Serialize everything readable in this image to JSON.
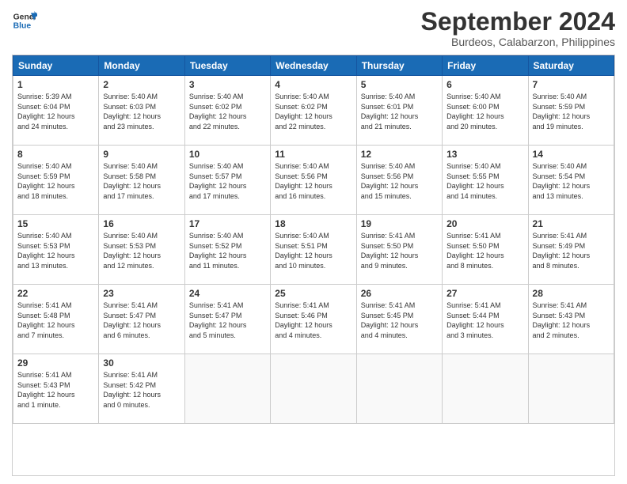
{
  "header": {
    "logo_line1": "General",
    "logo_line2": "Blue",
    "month": "September 2024",
    "location": "Burdeos, Calabarzon, Philippines"
  },
  "days_of_week": [
    "Sunday",
    "Monday",
    "Tuesday",
    "Wednesday",
    "Thursday",
    "Friday",
    "Saturday"
  ],
  "weeks": [
    [
      {
        "day": "1",
        "lines": [
          "Sunrise: 5:39 AM",
          "Sunset: 6:04 PM",
          "Daylight: 12 hours",
          "and 24 minutes."
        ]
      },
      {
        "day": "2",
        "lines": [
          "Sunrise: 5:40 AM",
          "Sunset: 6:03 PM",
          "Daylight: 12 hours",
          "and 23 minutes."
        ]
      },
      {
        "day": "3",
        "lines": [
          "Sunrise: 5:40 AM",
          "Sunset: 6:02 PM",
          "Daylight: 12 hours",
          "and 22 minutes."
        ]
      },
      {
        "day": "4",
        "lines": [
          "Sunrise: 5:40 AM",
          "Sunset: 6:02 PM",
          "Daylight: 12 hours",
          "and 22 minutes."
        ]
      },
      {
        "day": "5",
        "lines": [
          "Sunrise: 5:40 AM",
          "Sunset: 6:01 PM",
          "Daylight: 12 hours",
          "and 21 minutes."
        ]
      },
      {
        "day": "6",
        "lines": [
          "Sunrise: 5:40 AM",
          "Sunset: 6:00 PM",
          "Daylight: 12 hours",
          "and 20 minutes."
        ]
      },
      {
        "day": "7",
        "lines": [
          "Sunrise: 5:40 AM",
          "Sunset: 5:59 PM",
          "Daylight: 12 hours",
          "and 19 minutes."
        ]
      }
    ],
    [
      {
        "day": "8",
        "lines": [
          "Sunrise: 5:40 AM",
          "Sunset: 5:59 PM",
          "Daylight: 12 hours",
          "and 18 minutes."
        ]
      },
      {
        "day": "9",
        "lines": [
          "Sunrise: 5:40 AM",
          "Sunset: 5:58 PM",
          "Daylight: 12 hours",
          "and 17 minutes."
        ]
      },
      {
        "day": "10",
        "lines": [
          "Sunrise: 5:40 AM",
          "Sunset: 5:57 PM",
          "Daylight: 12 hours",
          "and 17 minutes."
        ]
      },
      {
        "day": "11",
        "lines": [
          "Sunrise: 5:40 AM",
          "Sunset: 5:56 PM",
          "Daylight: 12 hours",
          "and 16 minutes."
        ]
      },
      {
        "day": "12",
        "lines": [
          "Sunrise: 5:40 AM",
          "Sunset: 5:56 PM",
          "Daylight: 12 hours",
          "and 15 minutes."
        ]
      },
      {
        "day": "13",
        "lines": [
          "Sunrise: 5:40 AM",
          "Sunset: 5:55 PM",
          "Daylight: 12 hours",
          "and 14 minutes."
        ]
      },
      {
        "day": "14",
        "lines": [
          "Sunrise: 5:40 AM",
          "Sunset: 5:54 PM",
          "Daylight: 12 hours",
          "and 13 minutes."
        ]
      }
    ],
    [
      {
        "day": "15",
        "lines": [
          "Sunrise: 5:40 AM",
          "Sunset: 5:53 PM",
          "Daylight: 12 hours",
          "and 13 minutes."
        ]
      },
      {
        "day": "16",
        "lines": [
          "Sunrise: 5:40 AM",
          "Sunset: 5:53 PM",
          "Daylight: 12 hours",
          "and 12 minutes."
        ]
      },
      {
        "day": "17",
        "lines": [
          "Sunrise: 5:40 AM",
          "Sunset: 5:52 PM",
          "Daylight: 12 hours",
          "and 11 minutes."
        ]
      },
      {
        "day": "18",
        "lines": [
          "Sunrise: 5:40 AM",
          "Sunset: 5:51 PM",
          "Daylight: 12 hours",
          "and 10 minutes."
        ]
      },
      {
        "day": "19",
        "lines": [
          "Sunrise: 5:41 AM",
          "Sunset: 5:50 PM",
          "Daylight: 12 hours",
          "and 9 minutes."
        ]
      },
      {
        "day": "20",
        "lines": [
          "Sunrise: 5:41 AM",
          "Sunset: 5:50 PM",
          "Daylight: 12 hours",
          "and 8 minutes."
        ]
      },
      {
        "day": "21",
        "lines": [
          "Sunrise: 5:41 AM",
          "Sunset: 5:49 PM",
          "Daylight: 12 hours",
          "and 8 minutes."
        ]
      }
    ],
    [
      {
        "day": "22",
        "lines": [
          "Sunrise: 5:41 AM",
          "Sunset: 5:48 PM",
          "Daylight: 12 hours",
          "and 7 minutes."
        ]
      },
      {
        "day": "23",
        "lines": [
          "Sunrise: 5:41 AM",
          "Sunset: 5:47 PM",
          "Daylight: 12 hours",
          "and 6 minutes."
        ]
      },
      {
        "day": "24",
        "lines": [
          "Sunrise: 5:41 AM",
          "Sunset: 5:47 PM",
          "Daylight: 12 hours",
          "and 5 minutes."
        ]
      },
      {
        "day": "25",
        "lines": [
          "Sunrise: 5:41 AM",
          "Sunset: 5:46 PM",
          "Daylight: 12 hours",
          "and 4 minutes."
        ]
      },
      {
        "day": "26",
        "lines": [
          "Sunrise: 5:41 AM",
          "Sunset: 5:45 PM",
          "Daylight: 12 hours",
          "and 4 minutes."
        ]
      },
      {
        "day": "27",
        "lines": [
          "Sunrise: 5:41 AM",
          "Sunset: 5:44 PM",
          "Daylight: 12 hours",
          "and 3 minutes."
        ]
      },
      {
        "day": "28",
        "lines": [
          "Sunrise: 5:41 AM",
          "Sunset: 5:43 PM",
          "Daylight: 12 hours",
          "and 2 minutes."
        ]
      }
    ],
    [
      {
        "day": "29",
        "lines": [
          "Sunrise: 5:41 AM",
          "Sunset: 5:43 PM",
          "Daylight: 12 hours",
          "and 1 minute."
        ]
      },
      {
        "day": "30",
        "lines": [
          "Sunrise: 5:41 AM",
          "Sunset: 5:42 PM",
          "Daylight: 12 hours",
          "and 0 minutes."
        ]
      },
      null,
      null,
      null,
      null,
      null
    ]
  ]
}
